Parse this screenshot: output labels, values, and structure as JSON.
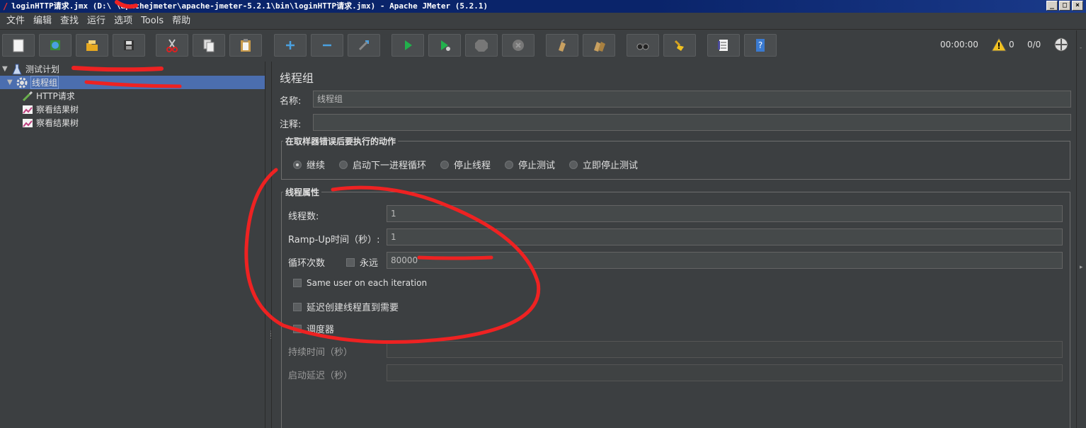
{
  "window": {
    "title": "loginHTTP请求.jmx (D:\\     \\apachejmeter\\apache-jmeter-5.2.1\\bin\\loginHTTP请求.jmx) - Apache JMeter (5.2.1)",
    "min": "_",
    "max": "□",
    "close": "×"
  },
  "menu": {
    "items": [
      "文件",
      "编辑",
      "查找",
      "运行",
      "选项",
      "Tools",
      "帮助"
    ]
  },
  "toolbar": {
    "buttons": [
      "new-icon",
      "templates-icon",
      "open-icon",
      "save-icon",
      "cut-icon",
      "copy-icon",
      "paste-icon",
      "expand-icon",
      "collapse-icon",
      "toggle-icon",
      "start-icon",
      "start-no-pause-icon",
      "stop-icon",
      "shutdown-icon",
      "clear-icon",
      "clear-all-icon",
      "search-icon",
      "reset-search-icon",
      "function-helper-icon",
      "help-icon"
    ],
    "timer": "00:00:00",
    "warning_count": "0",
    "threads_ratio": "0/0"
  },
  "tree": {
    "items": [
      {
        "label": "测试计划",
        "icon": "test-plan-icon"
      },
      {
        "label": "线程组",
        "icon": "gear-icon"
      },
      {
        "label": "HTTP请求",
        "icon": "sampler-icon"
      },
      {
        "label": "察看结果树",
        "icon": "listener-icon"
      },
      {
        "label": "察看结果树",
        "icon": "listener-icon"
      }
    ]
  },
  "panel": {
    "title": "线程组",
    "name_label": "名称:",
    "name_value": "线程组",
    "comment_label": "注释:",
    "comment_value": "",
    "error_group": {
      "legend": "在取样器错误后要执行的动作",
      "options": [
        "继续",
        "启动下一进程循环",
        "停止线程",
        "停止测试",
        "立即停止测试"
      ],
      "selected": "继续"
    },
    "thread_group": {
      "legend": "线程属性",
      "threads_label": "线程数:",
      "threads_value": "1",
      "rampup_label": "Ramp-Up时间（秒）:",
      "rampup_value": "1",
      "loop_label": "循环次数",
      "forever_label": "永远",
      "loop_value": "80000",
      "same_user_label": "Same user on each iteration",
      "delay_label": "延迟创建线程直到需要",
      "scheduler_label": "调度器",
      "duration_label": "持续时间（秒）",
      "duration_value": "",
      "startup_delay_label": "启动延迟（秒）",
      "startup_delay_value": ""
    }
  },
  "colors": {
    "background": "#3c3f41",
    "selection": "#4b6eaf",
    "title_bar": "#0a246a",
    "annotation": "#ee2222"
  }
}
